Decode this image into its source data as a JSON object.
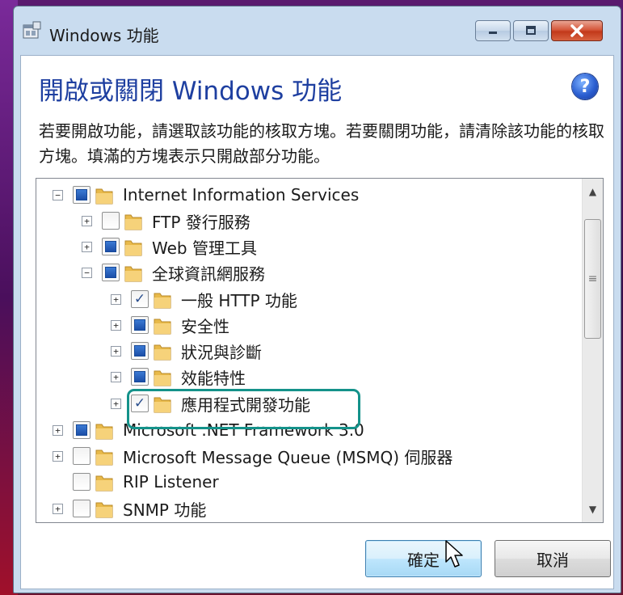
{
  "window": {
    "title": "Windows 功能"
  },
  "dialog": {
    "heading": "開啟或關閉 Windows 功能",
    "description": "若要開啟功能，請選取該功能的核取方塊。若要關閉功能，請清除該功能的核取方塊。填滿的方塊表示只開啟部分功能。"
  },
  "tree": {
    "items": [
      {
        "label": "Internet Information Services",
        "expander": "minus",
        "state": "partial"
      },
      {
        "label": "FTP 發行服務",
        "expander": "plus",
        "state": "unchecked"
      },
      {
        "label": "Web 管理工具",
        "expander": "plus",
        "state": "partial"
      },
      {
        "label": "全球資訊網服務",
        "expander": "minus",
        "state": "partial"
      },
      {
        "label": "一般 HTTP 功能",
        "expander": "plus",
        "state": "checked"
      },
      {
        "label": "安全性",
        "expander": "plus",
        "state": "partial"
      },
      {
        "label": "狀況與診斷",
        "expander": "plus",
        "state": "partial"
      },
      {
        "label": "效能特性",
        "expander": "plus",
        "state": "partial"
      },
      {
        "label": "應用程式開發功能",
        "expander": "plus",
        "state": "checked"
      },
      {
        "label": "Microsoft .NET Framework 3.0",
        "expander": "plus",
        "state": "partial"
      },
      {
        "label": "Microsoft Message Queue (MSMQ) 伺服器",
        "expander": "plus",
        "state": "unchecked"
      },
      {
        "label": "RIP Listener",
        "expander": "none",
        "state": "unchecked"
      },
      {
        "label": "SNMP 功能",
        "expander": "plus",
        "state": "unchecked"
      }
    ]
  },
  "buttons": {
    "ok": "確定",
    "cancel": "取消"
  },
  "icons": {
    "help": "?",
    "folder": "folder-icon",
    "app": "windows-features-icon"
  },
  "colors": {
    "highlight": "#14928a",
    "heading": "#1e3fa0"
  }
}
